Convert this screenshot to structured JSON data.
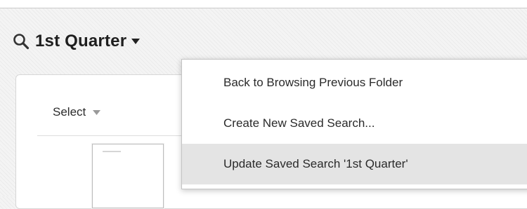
{
  "header": {
    "title": "1st Quarter",
    "search_icon": "search-icon",
    "caret_icon": "caret-down-icon"
  },
  "toolbar": {
    "select_label": "Select",
    "select_caret_icon": "caret-down-icon"
  },
  "menu": {
    "items": [
      {
        "label": "Back to Browsing Previous Folder",
        "highlighted": false
      },
      {
        "label": "Create New Saved Search...",
        "highlighted": false
      },
      {
        "label": "Update Saved Search '1st Quarter'",
        "highlighted": true
      }
    ]
  },
  "colors": {
    "text": "#1f1f1f",
    "menu_highlight": "#e4e4e4",
    "caret_gray": "#9a9a9a"
  }
}
